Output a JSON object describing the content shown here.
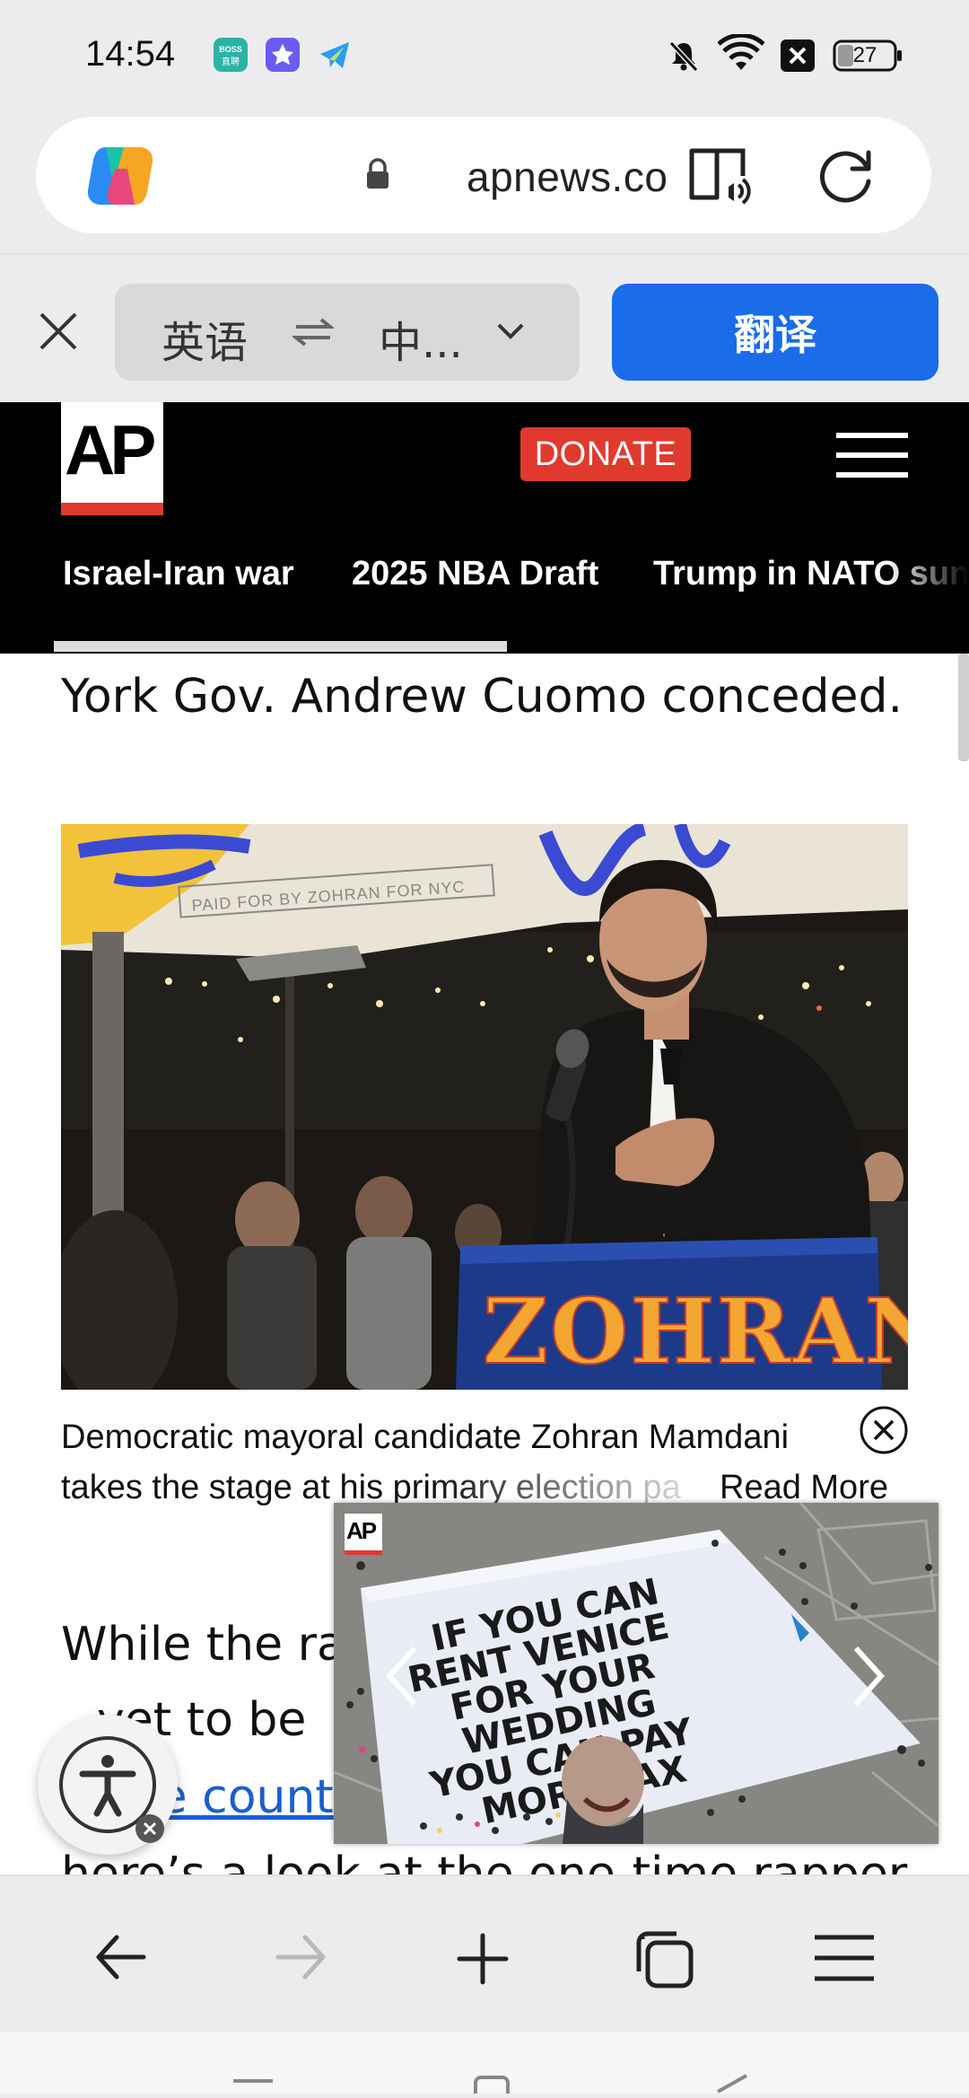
{
  "status_bar": {
    "time": "14:54",
    "battery": "27",
    "icons": [
      "boss-app-icon",
      "gallery-app-icon",
      "telegram-icon",
      "mute-icon",
      "wifi-icon",
      "x-icon",
      "battery-icon"
    ],
    "boss_icon_text": "BOSS 直聘"
  },
  "browser": {
    "url": "apnews.co",
    "logo": "copilot-icon"
  },
  "translate_bar": {
    "source_lang": "英语",
    "swap": "⇀↽",
    "target_lang": "中...",
    "translate_label": "翻译"
  },
  "site_header": {
    "logo_text": "AP",
    "donate_label": "DONATE",
    "nav_tabs": [
      "Israel-Iran war",
      "2025 NBA Draft",
      "Trump in NATO sun"
    ]
  },
  "article": {
    "line1": "York Gov. Andrew Cuomo conceded.",
    "photo_sign_text": "ZOHRAN",
    "photo_banner_text": "PAID FOR BY ZOHRAN FOR NYC",
    "caption_line1": "Democratic mayoral candidate Zohran Mamdani",
    "caption_line2": "takes the stage at his primary election pa",
    "read_more": "Read More",
    "para_line1": "While the rac",
    "para_line2": "yet to be",
    "para_link": "ce count",
    "para_line4": "here’s a look at the one-time rapper"
  },
  "video_popup": {
    "badge": "AP",
    "banner_lines": [
      "IF YOU CAN",
      "RENT VENICE",
      "FOR YOUR",
      "WEDDING",
      "YOU CAN PAY",
      "MORE TAX"
    ]
  },
  "colors": {
    "accent_blue": "#1a6ce8",
    "ap_red": "#e03a2f",
    "link_blue": "#1a5fd0"
  }
}
